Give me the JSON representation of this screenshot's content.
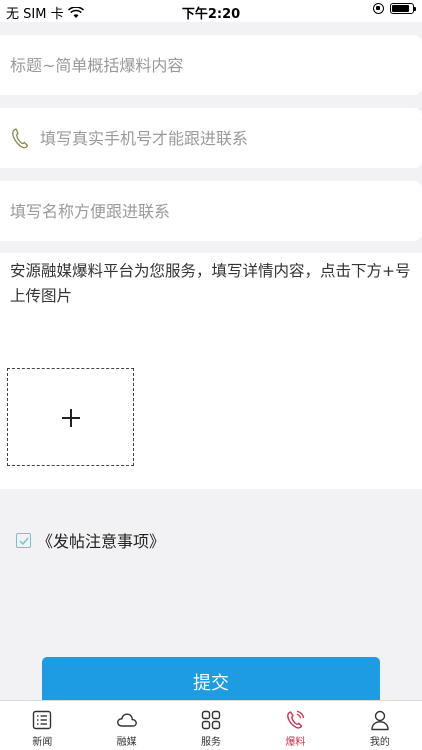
{
  "status_bar": {
    "carrier": "无 SIM 卡",
    "time": "下午2:20",
    "battery_level": 0.85
  },
  "form": {
    "title_placeholder": "标题~简单概括爆料内容",
    "phone_placeholder": "填写真实手机号才能跟进联系",
    "name_placeholder": "填写名称方便跟进联系",
    "content_placeholder": "安源融媒爆料平台为您服务，填写详情内容，点击下方+号上传图片",
    "upload_icon": "plus-icon"
  },
  "agreement": {
    "label": "《发帖注意事项》",
    "checked": true
  },
  "submit_label": "提交",
  "colors": {
    "accent": "#1d9be3",
    "active_tab": "#d0314c",
    "check": "#6cc8cc"
  },
  "tabs": [
    {
      "label": "新闻",
      "icon": "news-icon",
      "active": false
    },
    {
      "label": "融媒",
      "icon": "cloud-icon",
      "active": false
    },
    {
      "label": "服务",
      "icon": "grid-icon",
      "active": false
    },
    {
      "label": "爆料",
      "icon": "phone-icon",
      "active": true
    },
    {
      "label": "我的",
      "icon": "user-icon",
      "active": false
    }
  ]
}
